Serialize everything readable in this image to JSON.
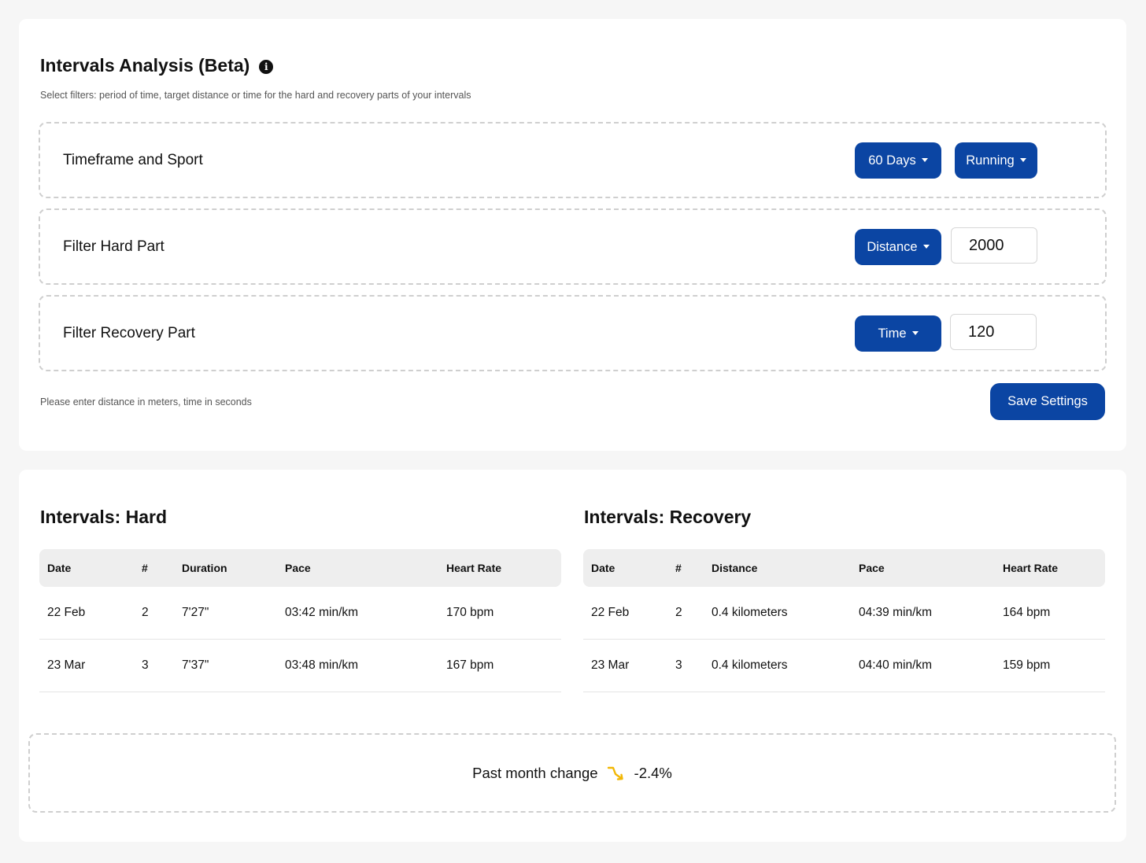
{
  "settings": {
    "title": "Intervals Analysis (Beta)",
    "info_glyph": "i",
    "subtitle": "Select filters: period of time, target distance or time for the hard and recovery parts of your intervals",
    "filters": [
      {
        "label": "Timeframe and Sport",
        "dropdown1": "60 Days",
        "dropdown2": "Running"
      },
      {
        "label": "Filter Hard Part",
        "dropdown": "Distance",
        "value": "2000"
      },
      {
        "label": "Filter Recovery Part",
        "dropdown": "Time",
        "value": "120"
      }
    ],
    "hint": "Please enter distance in meters, time in seconds",
    "save_label": "Save Settings"
  },
  "hard": {
    "title": "Intervals: Hard",
    "columns": [
      "Date",
      "#",
      "Duration",
      "Pace",
      "Heart Rate"
    ],
    "rows": [
      [
        "22 Feb",
        "2",
        "7'27\"",
        "03:42 min/km",
        "170 bpm"
      ],
      [
        "23 Mar",
        "3",
        "7'37\"",
        "03:48 min/km",
        "167 bpm"
      ]
    ]
  },
  "recovery": {
    "title": "Intervals: Recovery",
    "columns": [
      "Date",
      "#",
      "Distance",
      "Pace",
      "Heart Rate"
    ],
    "rows": [
      [
        "22 Feb",
        "2",
        "0.4 kilometers",
        "04:39 min/km",
        "164 bpm"
      ],
      [
        "23 Mar",
        "3",
        "0.4 kilometers",
        "04:40 min/km",
        "159 bpm"
      ]
    ]
  },
  "change": {
    "label": "Past month change",
    "icon": "trend-down-icon",
    "value": "-2.4%"
  },
  "colors": {
    "accent": "#0b45a3",
    "trend_icon": "#f2b705"
  }
}
